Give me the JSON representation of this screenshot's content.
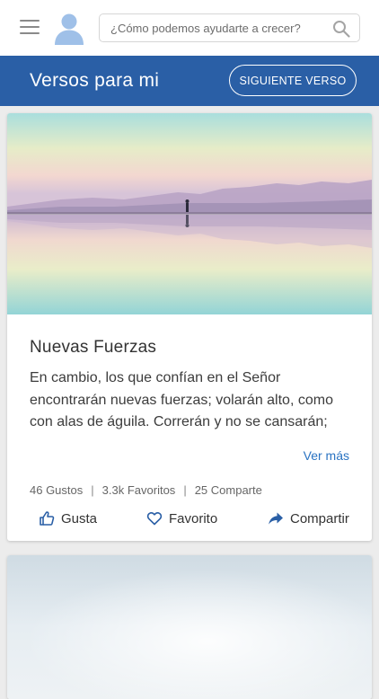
{
  "search": {
    "placeholder": "¿Cómo podemos ayudarte a crecer?"
  },
  "header": {
    "title": "Versos para mi",
    "next_label": "SIGUIENTE VERSO"
  },
  "card": {
    "title": "Nuevas Fuerzas",
    "text": "En cambio, los que confían en el Señor encontrarán nuevas fuerzas; volarán alto, como con alas de águila. Correrán y no se cansarán;",
    "more_label": "Ver más",
    "stats": {
      "likes": "46 Gustos",
      "favorites": "3.3k Favoritos",
      "shares": "25 Comparte"
    },
    "actions": {
      "like": "Gusta",
      "favorite": "Favorito",
      "share": "Compartir"
    }
  },
  "colors": {
    "header": "#2a5fa6",
    "link": "#2a73c2",
    "icon": "#2a5fa6"
  }
}
